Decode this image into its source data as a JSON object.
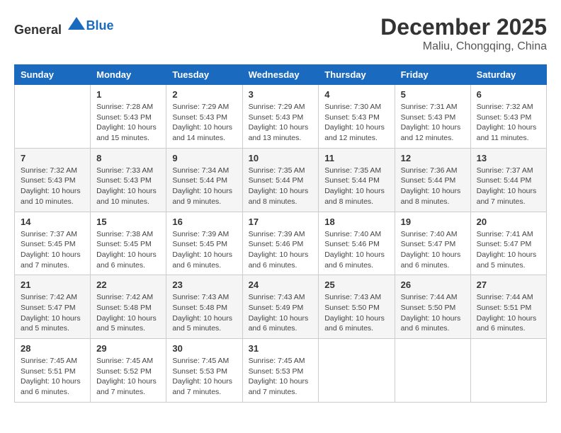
{
  "header": {
    "logo": {
      "general": "General",
      "blue": "Blue"
    },
    "month": "December 2025",
    "location": "Maliu, Chongqing, China"
  },
  "weekdays": [
    "Sunday",
    "Monday",
    "Tuesday",
    "Wednesday",
    "Thursday",
    "Friday",
    "Saturday"
  ],
  "weeks": [
    [
      {
        "day": "",
        "info": ""
      },
      {
        "day": "1",
        "info": "Sunrise: 7:28 AM\nSunset: 5:43 PM\nDaylight: 10 hours\nand 15 minutes."
      },
      {
        "day": "2",
        "info": "Sunrise: 7:29 AM\nSunset: 5:43 PM\nDaylight: 10 hours\nand 14 minutes."
      },
      {
        "day": "3",
        "info": "Sunrise: 7:29 AM\nSunset: 5:43 PM\nDaylight: 10 hours\nand 13 minutes."
      },
      {
        "day": "4",
        "info": "Sunrise: 7:30 AM\nSunset: 5:43 PM\nDaylight: 10 hours\nand 12 minutes."
      },
      {
        "day": "5",
        "info": "Sunrise: 7:31 AM\nSunset: 5:43 PM\nDaylight: 10 hours\nand 12 minutes."
      },
      {
        "day": "6",
        "info": "Sunrise: 7:32 AM\nSunset: 5:43 PM\nDaylight: 10 hours\nand 11 minutes."
      }
    ],
    [
      {
        "day": "7",
        "info": "Sunrise: 7:32 AM\nSunset: 5:43 PM\nDaylight: 10 hours\nand 10 minutes."
      },
      {
        "day": "8",
        "info": "Sunrise: 7:33 AM\nSunset: 5:43 PM\nDaylight: 10 hours\nand 10 minutes."
      },
      {
        "day": "9",
        "info": "Sunrise: 7:34 AM\nSunset: 5:44 PM\nDaylight: 10 hours\nand 9 minutes."
      },
      {
        "day": "10",
        "info": "Sunrise: 7:35 AM\nSunset: 5:44 PM\nDaylight: 10 hours\nand 8 minutes."
      },
      {
        "day": "11",
        "info": "Sunrise: 7:35 AM\nSunset: 5:44 PM\nDaylight: 10 hours\nand 8 minutes."
      },
      {
        "day": "12",
        "info": "Sunrise: 7:36 AM\nSunset: 5:44 PM\nDaylight: 10 hours\nand 8 minutes."
      },
      {
        "day": "13",
        "info": "Sunrise: 7:37 AM\nSunset: 5:44 PM\nDaylight: 10 hours\nand 7 minutes."
      }
    ],
    [
      {
        "day": "14",
        "info": "Sunrise: 7:37 AM\nSunset: 5:45 PM\nDaylight: 10 hours\nand 7 minutes."
      },
      {
        "day": "15",
        "info": "Sunrise: 7:38 AM\nSunset: 5:45 PM\nDaylight: 10 hours\nand 6 minutes."
      },
      {
        "day": "16",
        "info": "Sunrise: 7:39 AM\nSunset: 5:45 PM\nDaylight: 10 hours\nand 6 minutes."
      },
      {
        "day": "17",
        "info": "Sunrise: 7:39 AM\nSunset: 5:46 PM\nDaylight: 10 hours\nand 6 minutes."
      },
      {
        "day": "18",
        "info": "Sunrise: 7:40 AM\nSunset: 5:46 PM\nDaylight: 10 hours\nand 6 minutes."
      },
      {
        "day": "19",
        "info": "Sunrise: 7:40 AM\nSunset: 5:47 PM\nDaylight: 10 hours\nand 6 minutes."
      },
      {
        "day": "20",
        "info": "Sunrise: 7:41 AM\nSunset: 5:47 PM\nDaylight: 10 hours\nand 5 minutes."
      }
    ],
    [
      {
        "day": "21",
        "info": "Sunrise: 7:42 AM\nSunset: 5:47 PM\nDaylight: 10 hours\nand 5 minutes."
      },
      {
        "day": "22",
        "info": "Sunrise: 7:42 AM\nSunset: 5:48 PM\nDaylight: 10 hours\nand 5 minutes."
      },
      {
        "day": "23",
        "info": "Sunrise: 7:43 AM\nSunset: 5:48 PM\nDaylight: 10 hours\nand 5 minutes."
      },
      {
        "day": "24",
        "info": "Sunrise: 7:43 AM\nSunset: 5:49 PM\nDaylight: 10 hours\nand 6 minutes."
      },
      {
        "day": "25",
        "info": "Sunrise: 7:43 AM\nSunset: 5:50 PM\nDaylight: 10 hours\nand 6 minutes."
      },
      {
        "day": "26",
        "info": "Sunrise: 7:44 AM\nSunset: 5:50 PM\nDaylight: 10 hours\nand 6 minutes."
      },
      {
        "day": "27",
        "info": "Sunrise: 7:44 AM\nSunset: 5:51 PM\nDaylight: 10 hours\nand 6 minutes."
      }
    ],
    [
      {
        "day": "28",
        "info": "Sunrise: 7:45 AM\nSunset: 5:51 PM\nDaylight: 10 hours\nand 6 minutes."
      },
      {
        "day": "29",
        "info": "Sunrise: 7:45 AM\nSunset: 5:52 PM\nDaylight: 10 hours\nand 7 minutes."
      },
      {
        "day": "30",
        "info": "Sunrise: 7:45 AM\nSunset: 5:53 PM\nDaylight: 10 hours\nand 7 minutes."
      },
      {
        "day": "31",
        "info": "Sunrise: 7:45 AM\nSunset: 5:53 PM\nDaylight: 10 hours\nand 7 minutes."
      },
      {
        "day": "",
        "info": ""
      },
      {
        "day": "",
        "info": ""
      },
      {
        "day": "",
        "info": ""
      }
    ]
  ]
}
